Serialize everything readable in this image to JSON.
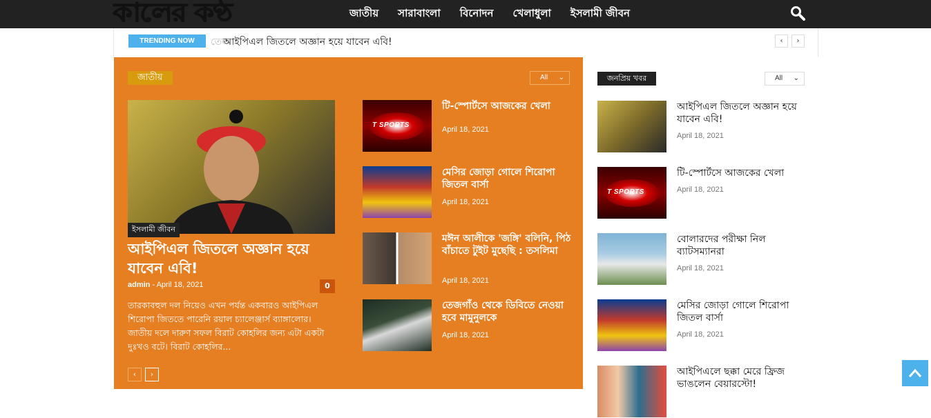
{
  "header": {
    "logo_text": "কালের কণ্ঠ",
    "nav": [
      "জাতীয়",
      "সারাবাংলা",
      "বিনোদন",
      "খেলাধুলা",
      "ইসলামী জীবন"
    ]
  },
  "trending": {
    "badge": "TRENDING NOW",
    "ghost_text": "তেজ",
    "headline": "আইপিএল জিতলে অজ্ঞান হয়ে যাবেন এবি!",
    "prev": "‹",
    "next": "›"
  },
  "main_block": {
    "section_label": "জাতীয়",
    "filter_label": "All",
    "featured": {
      "category": "ইসলামী জীবন",
      "title": "আইপিএল জিতলে অজ্ঞান হয়ে যাবেন এবি!",
      "author": "admin",
      "separator": "-",
      "date": "April 18, 2021",
      "comments": "0",
      "excerpt": "তারকাবহুল দল নিয়েও এখন পর্যন্ত একবারও আইপিএল শিরোপা জিততে পারেনি রয়াল চ্যালেঞ্জার্স ব্যাঙ্গালোর। জাতীয় দলে দারুণ সফল বিরাট কোহলির জন্য এটা একটা দুঃখও বটে। বিরাট কোহলির..."
    },
    "list": [
      {
        "title": "টি-স্পোর্টসে আজকের খেলা",
        "date": "April 18, 2021",
        "thumb": "tsports"
      },
      {
        "title": "মেসির জোড়া গোলে শিরোপা জিতল বার্সা",
        "date": "April 18, 2021",
        "thumb": "barca"
      },
      {
        "title": "মঈন আলীকে 'জঙ্গি' বলিনি, পিঠ বাঁচাতে টুইট মুছেছি : তসলিমা",
        "date": "April 18, 2021",
        "thumb": "moeen"
      },
      {
        "title": "তেজগাঁও থেকে ডিবিতে নেওয়া হবে মামুনুলকে",
        "date": "April 18, 2021",
        "thumb": "crowd"
      }
    ],
    "pager_prev": "‹",
    "pager_next": "›"
  },
  "sidebar": {
    "section_label": "জনপ্রিয় খবর",
    "filter_label": "All",
    "items": [
      {
        "title": "আইপিএল জিতলে অজ্ঞান হয়ে যাবেন এবি!",
        "date": "April 18, 2021",
        "thumb": "abd"
      },
      {
        "title": "টি-স্পোর্টসে আজকের খেলা",
        "date": "April 18, 2021",
        "thumb": "tsports"
      },
      {
        "title": "বোলারদের পরীক্ষা নিল ব্যাটসম্যানরা",
        "date": "April 18, 2021",
        "thumb": "cricket"
      },
      {
        "title": "মেসির জোড়া গোলে শিরোপা জিতল বার্সা",
        "date": "April 18, 2021",
        "thumb": "barca"
      },
      {
        "title": "আইপিএলে ছক্কা মেরে ফ্রিজ ভাঙলেন বেয়ারস্টো!",
        "date": "",
        "thumb": "ipl2"
      }
    ]
  },
  "tsports_label": "T SPORTS",
  "icons": {
    "search": "search-icon",
    "scroll_top": "arrow-up-icon"
  },
  "colors": {
    "accent_orange": "#e67e22",
    "accent_blue": "#4db2ec",
    "topbar": "#222222"
  }
}
